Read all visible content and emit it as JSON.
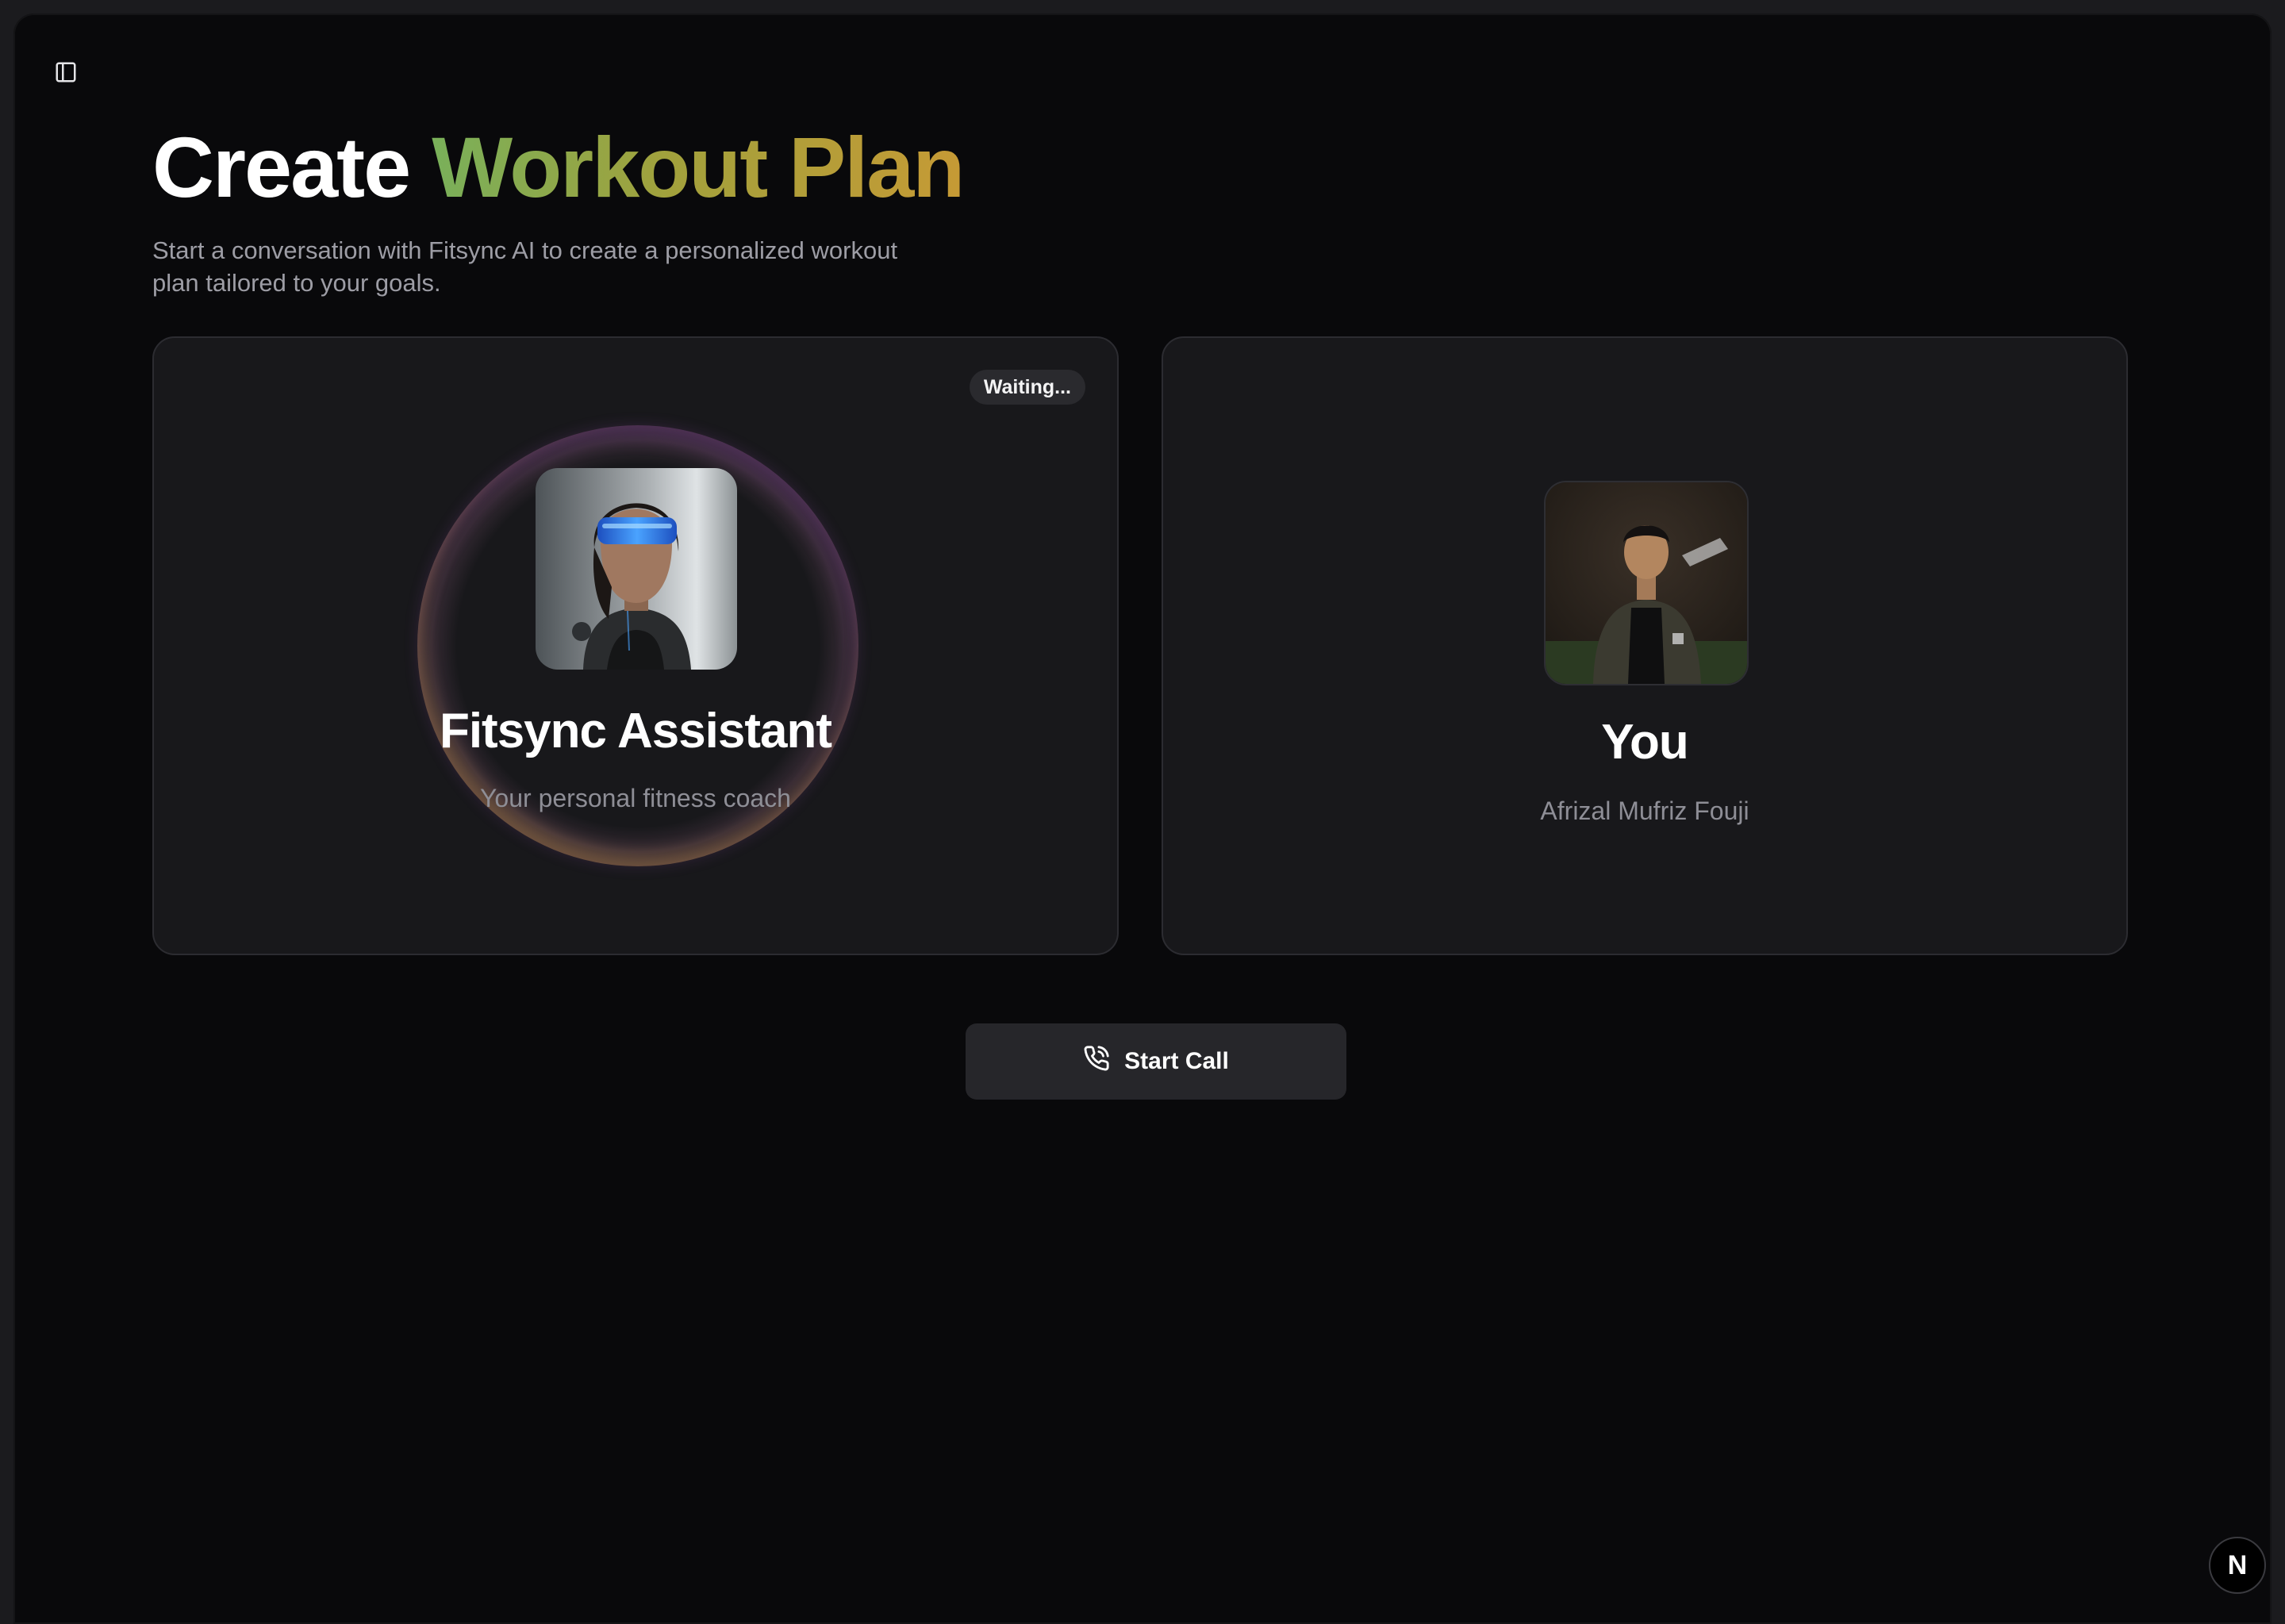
{
  "header": {
    "sidebar_toggle_icon": "sidebar-panel-icon",
    "title_plain": "Create",
    "title_accent": "Workout Plan",
    "subtitle": "Start a conversation with Fitsync AI to create a personalized workout plan tailored to your goals."
  },
  "assistant_card": {
    "status": "Waiting...",
    "name": "Fitsync Assistant",
    "description": "Your personal fitness coach",
    "avatar_icon": "ai-assistant-avatar"
  },
  "user_card": {
    "name": "You",
    "full_name": "Afrizal Mufriz Fouji",
    "avatar_icon": "user-avatar"
  },
  "actions": {
    "start_call_label": "Start Call",
    "start_call_icon": "phone-call-icon"
  },
  "dev_badge": {
    "label": "N"
  },
  "colors": {
    "background": "#09090b",
    "card": "#18181b",
    "accent_start": "#79b05a",
    "accent_end": "#c69a35",
    "ring_purple": "#9650af",
    "ring_orange": "#cd945c"
  }
}
